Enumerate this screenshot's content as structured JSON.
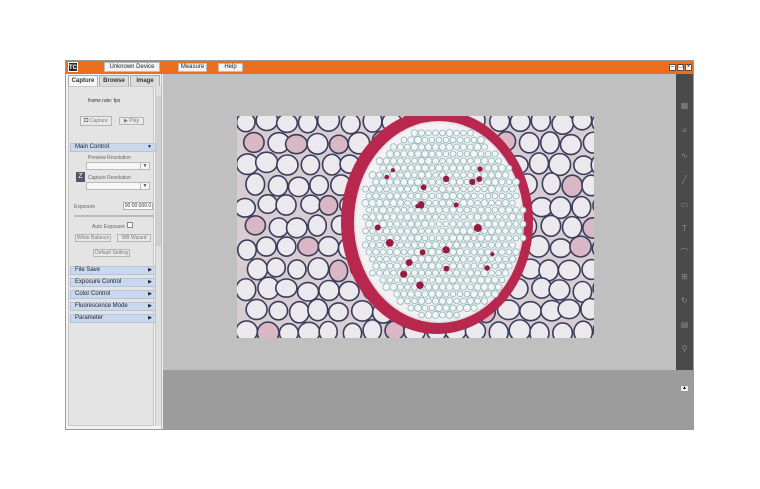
{
  "titlebar": {
    "logo_text": "TC",
    "device_label": "Unknown Device",
    "menu": [
      "Measure",
      "Help"
    ],
    "window_controls": [
      "minimize-icon",
      "maximize-icon",
      "close-icon"
    ]
  },
  "left_panel": {
    "tabs": [
      {
        "label": "Capture",
        "active": true
      },
      {
        "label": "Browse",
        "active": false
      },
      {
        "label": "Image",
        "active": false
      }
    ],
    "frame_rate_label": "frame rate: fps",
    "capture_button": "Capture",
    "play_button": "Play",
    "main_control": {
      "title": "Main Control",
      "preview_resolution_label": "Preview Resolution",
      "capture_resolution_label": "Capture Resolution",
      "exposure_label": "Exposure",
      "exposure_time": "00:00:000.0",
      "auto_exposure_label": "Auto Exposure",
      "white_balance_button": "White Balance",
      "wb_wizard_button": "WB Wizard",
      "default_setting_button": "Default Setting"
    },
    "sections": [
      "File Save",
      "Exposure Control",
      "Color Control",
      "Fluorescence Mode",
      "Parameter"
    ]
  },
  "right_toolbar": {
    "icons": [
      "grid-icon",
      "list-icon",
      "brush-icon",
      "line-icon",
      "rect-icon",
      "text-icon",
      "curve-icon",
      "ruler-icon",
      "rotate-icon",
      "page-icon",
      "pin-icon"
    ]
  },
  "colors": {
    "titlebar": "#e96f1e",
    "section_bar": "#c9d8ec",
    "viewer_bg": "#c0c0c0",
    "lower_bg": "#9c9c9c",
    "toolbar_bg": "#4a4a4a"
  }
}
